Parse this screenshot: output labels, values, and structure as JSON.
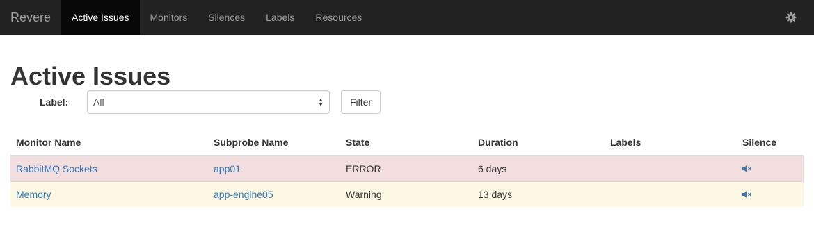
{
  "nav": {
    "brand": "Revere",
    "items": [
      {
        "label": "Active Issues",
        "active": true
      },
      {
        "label": "Monitors",
        "active": false
      },
      {
        "label": "Silences",
        "active": false
      },
      {
        "label": "Labels",
        "active": false
      },
      {
        "label": "Resources",
        "active": false
      }
    ],
    "settings_icon": "gear-icon"
  },
  "page": {
    "title": "Active Issues",
    "filter": {
      "label": "Label:",
      "selected": "All",
      "button": "Filter"
    }
  },
  "table": {
    "headers": [
      "Monitor Name",
      "Subprobe Name",
      "State",
      "Duration",
      "Labels",
      "Silence"
    ],
    "rows": [
      {
        "monitor": "RabbitMQ Sockets",
        "subprobe": "app01",
        "state": "ERROR",
        "duration": "6 days",
        "labels": "",
        "status": "danger",
        "silence_icon": "mute-icon"
      },
      {
        "monitor": "Memory",
        "subprobe": "app-engine05",
        "state": "Warning",
        "duration": "13 days",
        "labels": "",
        "status": "warning",
        "silence_icon": "mute-icon"
      }
    ]
  },
  "colors": {
    "navbar": "#222222",
    "link": "#337ab7",
    "danger_row": "#f2dede",
    "warning_row": "#fcf8e3"
  }
}
